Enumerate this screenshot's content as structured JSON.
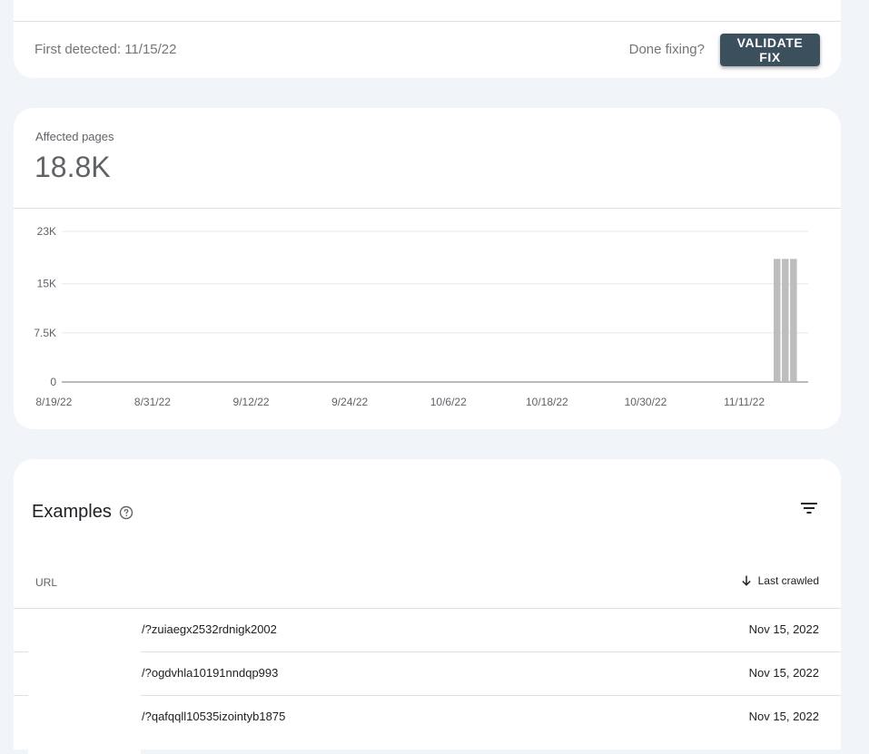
{
  "top_card": {
    "first_detected": "First detected: 11/15/22",
    "done_fixing": "Done fixing?",
    "validate_label": "VALIDATE FIX"
  },
  "colors": {
    "page_bg": "#f1f4f9",
    "button_bg": "#3c4f5c",
    "bar": "#bdbdbd",
    "text_muted": "#5f6368"
  },
  "affected": {
    "label": "Affected pages",
    "value": "18.8K"
  },
  "chart_data": {
    "type": "bar",
    "title": "",
    "xlabel": "",
    "ylabel": "",
    "ylim": [
      0,
      23000
    ],
    "y_ticks": [
      "0",
      "7.5K",
      "15K",
      "23K"
    ],
    "y_tick_values": [
      0,
      7500,
      15000,
      23000
    ],
    "x_tick_labels": [
      "8/19/22",
      "8/31/22",
      "9/12/22",
      "9/24/22",
      "10/6/22",
      "10/18/22",
      "10/30/22",
      "11/11/22"
    ],
    "categories": [
      "8/19/22",
      "8/20/22",
      "8/21/22",
      "8/22/22",
      "8/23/22",
      "8/24/22",
      "8/25/22",
      "8/26/22",
      "8/27/22",
      "8/28/22",
      "8/29/22",
      "8/30/22",
      "8/31/22",
      "9/1/22",
      "9/2/22",
      "9/3/22",
      "9/4/22",
      "9/5/22",
      "9/6/22",
      "9/7/22",
      "9/8/22",
      "9/9/22",
      "9/10/22",
      "9/11/22",
      "9/12/22",
      "9/13/22",
      "9/14/22",
      "9/15/22",
      "9/16/22",
      "9/17/22",
      "9/18/22",
      "9/19/22",
      "9/20/22",
      "9/21/22",
      "9/22/22",
      "9/23/22",
      "9/24/22",
      "9/25/22",
      "9/26/22",
      "9/27/22",
      "9/28/22",
      "9/29/22",
      "9/30/22",
      "10/1/22",
      "10/2/22",
      "10/3/22",
      "10/4/22",
      "10/5/22",
      "10/6/22",
      "10/7/22",
      "10/8/22",
      "10/9/22",
      "10/10/22",
      "10/11/22",
      "10/12/22",
      "10/13/22",
      "10/14/22",
      "10/15/22",
      "10/16/22",
      "10/17/22",
      "10/18/22",
      "10/19/22",
      "10/20/22",
      "10/21/22",
      "10/22/22",
      "10/23/22",
      "10/24/22",
      "10/25/22",
      "10/26/22",
      "10/27/22",
      "10/28/22",
      "10/29/22",
      "10/30/22",
      "10/31/22",
      "11/1/22",
      "11/2/22",
      "11/3/22",
      "11/4/22",
      "11/5/22",
      "11/6/22",
      "11/7/22",
      "11/8/22",
      "11/9/22",
      "11/10/22",
      "11/11/22",
      "11/12/22",
      "11/13/22",
      "11/14/22",
      "11/15/22",
      "11/16/22",
      "11/17/22"
    ],
    "values": [
      0,
      0,
      0,
      0,
      0,
      0,
      0,
      0,
      0,
      0,
      0,
      0,
      0,
      0,
      0,
      0,
      0,
      0,
      0,
      0,
      0,
      0,
      0,
      0,
      0,
      0,
      0,
      0,
      0,
      0,
      0,
      0,
      0,
      0,
      0,
      0,
      0,
      0,
      0,
      0,
      0,
      0,
      0,
      0,
      0,
      0,
      0,
      0,
      0,
      0,
      0,
      0,
      0,
      0,
      0,
      0,
      0,
      0,
      0,
      0,
      0,
      0,
      0,
      0,
      0,
      0,
      0,
      0,
      0,
      0,
      0,
      0,
      0,
      0,
      0,
      0,
      0,
      0,
      0,
      0,
      0,
      0,
      0,
      0,
      0,
      0,
      0,
      0,
      18800,
      18800,
      18800
    ],
    "grid": true,
    "legend": "none"
  },
  "examples": {
    "title": "Examples",
    "col_url": "URL",
    "col_last_crawled": "Last crawled",
    "rows": [
      {
        "url": "/?zuiaegx2532rdnigk2002",
        "date": "Nov 15, 2022"
      },
      {
        "url": "/?ogdvhla10191nndqp993",
        "date": "Nov 15, 2022"
      },
      {
        "url": "/?qafqqll10535izointyb1875",
        "date": "Nov 15, 2022"
      }
    ]
  }
}
